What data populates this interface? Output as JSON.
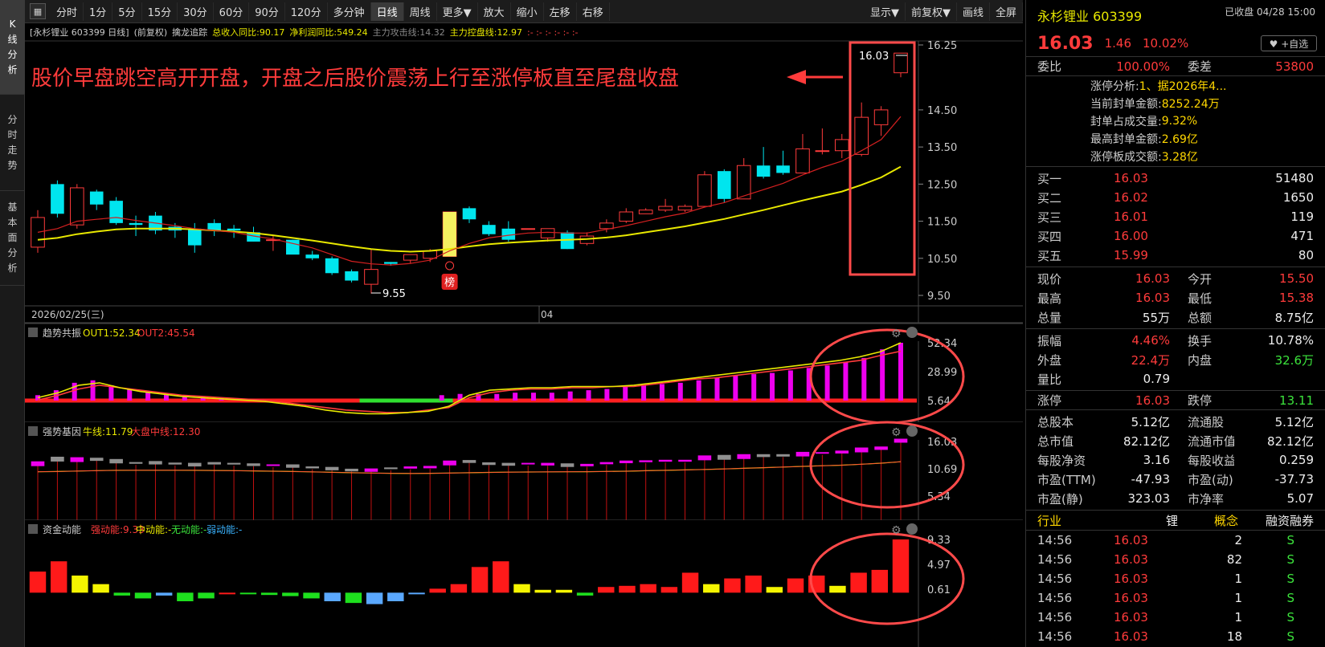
{
  "left_nav": [
    {
      "label": "K线分析",
      "active": true
    },
    {
      "label": "分时走势",
      "active": false
    },
    {
      "label": "基本面分析",
      "active": false
    }
  ],
  "toolbar": {
    "left": [
      "分时",
      "1分",
      "5分",
      "15分",
      "30分",
      "60分",
      "90分",
      "120分",
      "多分钟",
      "日线",
      "周线",
      "更多▼",
      "放大",
      "缩小",
      "左移",
      "右移"
    ],
    "active": "日线",
    "right": [
      "显示▼",
      "前复权▼",
      "画线",
      "全屏"
    ]
  },
  "infobar": {
    "stock": "[永杉锂业 603399 日线]",
    "adj": "(前复权)",
    "indicator": "擒龙追踪",
    "revenue": "总收入同比:90.17",
    "profit": "净利润同比:549.24",
    "attack": "主力攻击线:14.32",
    "control": "主力控盘线:12.97",
    "marks": ":- :- :- :- :- :-"
  },
  "main_chart": {
    "annotation": "股价早盘跳空高开开盘，开盘之后股价震荡上行至涨停板直至尾盘收盘",
    "label_high": "16.03",
    "label_low": "9.55",
    "date_left": "2026/02/25(三)",
    "date_mid": "04",
    "badge": "榜",
    "y_ticks": [
      "16.25",
      "14.50",
      "13.50",
      "12.50",
      "11.50",
      "10.50",
      "9.50"
    ]
  },
  "ind1": {
    "name": "趋势共振",
    "out1": "OUT1:52.34",
    "out2": "OUT2:45.54",
    "ticks": [
      "52.34",
      "28.99",
      "5.64"
    ]
  },
  "ind2": {
    "name": "强势基因",
    "bull": "牛线:11.79",
    "mid": "大盘中线:12.30",
    "ticks": [
      "16.03",
      "10.69",
      "5.34"
    ]
  },
  "ind3": {
    "name": "资金动能",
    "strong": "强动能:9.33",
    "medium": "中动能:-",
    "none": "无动能:-",
    "weak": "弱动能:-",
    "ticks": [
      "9.33",
      "4.97",
      "0.61"
    ]
  },
  "chart_data": {
    "type": "candlestick",
    "candles": [
      [
        10.8,
        11.6,
        11.8,
        10.65
      ],
      [
        12.5,
        11.7,
        12.6,
        11.6
      ],
      [
        11.4,
        12.4,
        12.5,
        11.3
      ],
      [
        12.3,
        11.95,
        12.35,
        11.8
      ],
      [
        12.05,
        11.45,
        12.15,
        11.4
      ],
      [
        11.45,
        11.4,
        11.65,
        11.1
      ],
      [
        11.65,
        11.25,
        11.75,
        11.15
      ],
      [
        11.35,
        11.25,
        11.45,
        11.05
      ],
      [
        11.3,
        10.85,
        11.45,
        10.65
      ],
      [
        11.45,
        11.25,
        11.55,
        11.1
      ],
      [
        11.3,
        11.25,
        11.4,
        11.05
      ],
      [
        11.2,
        10.95,
        11.35,
        10.95
      ],
      [
        10.98,
        11.0,
        11.1,
        10.7
      ],
      [
        11.0,
        10.6,
        11.0,
        10.7
      ],
      [
        10.6,
        10.5,
        10.7,
        10.45
      ],
      [
        10.5,
        10.1,
        10.55,
        10.05
      ],
      [
        10.15,
        9.9,
        10.2,
        9.85
      ],
      [
        9.8,
        10.2,
        10.75,
        9.55
      ],
      [
        10.4,
        10.35,
        10.4,
        10.3
      ],
      [
        10.45,
        10.6,
        10.6,
        10.35
      ],
      [
        10.5,
        10.7,
        10.75,
        10.4
      ],
      [
        10.55,
        11.75,
        11.75,
        10.55
      ],
      [
        11.85,
        11.55,
        11.9,
        11.45
      ],
      [
        11.4,
        11.15,
        11.5,
        11.1
      ],
      [
        11.3,
        11.0,
        11.5,
        10.95
      ],
      [
        11.3,
        11.3,
        11.3,
        11.3
      ],
      [
        11.05,
        11.3,
        11.3,
        10.95
      ],
      [
        11.2,
        10.75,
        11.25,
        10.75
      ],
      [
        10.9,
        11.1,
        11.2,
        10.85
      ],
      [
        11.3,
        11.45,
        11.55,
        11.2
      ],
      [
        11.5,
        11.75,
        11.85,
        11.45
      ],
      [
        11.7,
        11.8,
        11.85,
        11.7
      ],
      [
        11.8,
        11.9,
        12.1,
        11.75
      ],
      [
        11.8,
        11.9,
        11.95,
        11.75
      ],
      [
        11.9,
        12.75,
        12.85,
        11.9
      ],
      [
        12.85,
        12.1,
        12.9,
        12.0
      ],
      [
        12.1,
        13.0,
        13.2,
        12.1
      ],
      [
        13.0,
        12.7,
        13.5,
        12.65
      ],
      [
        13.0,
        12.8,
        13.4,
        12.75
      ],
      [
        12.8,
        13.45,
        13.85,
        12.8
      ],
      [
        13.4,
        13.4,
        14.0,
        13.3
      ],
      [
        13.4,
        13.7,
        13.85,
        13.2
      ],
      [
        13.3,
        14.3,
        14.7,
        13.25
      ],
      [
        14.1,
        14.5,
        14.6,
        13.8
      ],
      [
        15.5,
        16.03,
        16.03,
        15.38
      ]
    ],
    "ma_red": [
      11.2,
      11.3,
      11.5,
      11.55,
      11.6,
      11.52,
      11.45,
      11.38,
      11.3,
      11.25,
      11.2,
      11.1,
      11.02,
      10.9,
      10.78,
      10.6,
      10.42,
      10.35,
      10.32,
      10.36,
      10.45,
      10.7,
      10.9,
      11.05,
      11.12,
      11.18,
      11.2,
      11.18,
      11.18,
      11.28,
      11.38,
      11.5,
      11.62,
      11.72,
      11.88,
      12.0,
      12.18,
      12.35,
      12.52,
      12.75,
      12.95,
      13.12,
      13.4,
      13.7,
      14.32
    ],
    "ma_yellow": [
      11.0,
      11.05,
      11.15,
      11.22,
      11.28,
      11.3,
      11.3,
      11.3,
      11.28,
      11.25,
      11.22,
      11.18,
      11.12,
      11.05,
      10.98,
      10.9,
      10.82,
      10.75,
      10.7,
      10.68,
      10.7,
      10.75,
      10.82,
      10.88,
      10.92,
      10.95,
      10.98,
      11.0,
      11.02,
      11.06,
      11.12,
      11.2,
      11.28,
      11.36,
      11.46,
      11.56,
      11.68,
      11.8,
      11.93,
      12.06,
      12.18,
      12.3,
      12.48,
      12.68,
      12.97
    ],
    "ind1_bars": [
      10,
      14,
      20,
      22,
      18,
      15,
      13,
      11,
      10,
      9,
      8,
      7,
      6,
      5,
      3,
      1,
      0,
      0,
      0,
      0,
      0,
      2,
      10,
      11,
      11,
      11,
      12,
      12,
      12,
      13,
      14,
      15,
      17,
      18,
      19,
      20,
      22,
      24,
      26,
      27,
      28,
      30,
      32,
      34,
      37,
      40,
      47,
      52.34
    ],
    "ind1_out1": [
      8,
      12,
      18,
      20,
      16,
      13,
      11,
      9,
      8,
      7,
      6,
      5,
      3,
      1,
      -2,
      -4,
      -5,
      -5,
      -4,
      -3,
      1,
      10,
      14,
      15,
      16,
      16,
      17,
      17,
      17,
      18,
      20,
      22,
      24,
      26,
      28,
      30,
      32,
      34,
      36,
      38,
      41,
      45,
      52.34
    ],
    "ind1_out2": [
      6,
      10,
      15,
      18,
      16,
      14,
      12,
      10,
      9,
      8,
      7,
      6,
      4,
      2,
      0,
      -2,
      -3,
      -4,
      -4,
      -2,
      0,
      8,
      12,
      14,
      15,
      15,
      16,
      16,
      17,
      17,
      19,
      21,
      23,
      24,
      26,
      28,
      30,
      32,
      34,
      36,
      38,
      42,
      45.54
    ],
    "ind1_base": [
      "red",
      "red",
      "red",
      "red",
      "red",
      "red",
      "red",
      "red",
      "red",
      "red",
      "red",
      "red",
      "red",
      "red",
      "red",
      "red",
      "green",
      "green",
      "green",
      "green",
      "green",
      "green",
      "red",
      "red",
      "red",
      "red",
      "red",
      "red",
      "red",
      "red",
      "red",
      "red",
      "red",
      "red",
      "red",
      "red",
      "red",
      "red",
      "red",
      "red",
      "red",
      "red",
      "red",
      "red",
      "red"
    ],
    "ind3_bars": [
      3.7,
      5.5,
      3.0,
      1.5,
      -0.5,
      -1.0,
      -0.5,
      -1.5,
      -1.0,
      0.0,
      -0.2,
      -0.4,
      -0.6,
      -1.0,
      -1.5,
      -1.8,
      -2.0,
      -1.5,
      -0.2,
      0.7,
      1.5,
      4.5,
      5.5,
      1.5,
      0.5,
      0.5,
      -0.5,
      1.0,
      1.2,
      1.5,
      1.0,
      3.5,
      1.5,
      2.5,
      3.0,
      1.0,
      2.5,
      3.0,
      1.2,
      3.5,
      4.0,
      9.33
    ],
    "ind3_colors": [
      "red",
      "red",
      "yellow",
      "yellow",
      "green",
      "green",
      "blue",
      "green",
      "green",
      "red",
      "green",
      "green",
      "green",
      "green",
      "blue",
      "green",
      "blue",
      "blue",
      "blue",
      "red",
      "red",
      "red",
      "red",
      "yellow",
      "yellow",
      "yellow",
      "green",
      "red",
      "red",
      "red",
      "red",
      "red",
      "yellow",
      "red",
      "red",
      "yellow",
      "red",
      "red",
      "yellow",
      "red",
      "red",
      "red"
    ]
  },
  "right_panel": {
    "name": "永杉锂业 603399",
    "closed": "已收盘 04/28 15:00",
    "price": "16.03",
    "change": "1.46",
    "pct": "10.02%",
    "fav": "♥ +自选",
    "weibi_label": "委比",
    "weibi": "100.00%",
    "weicha_label": "委差",
    "weicha": "53800",
    "zt_analysis": [
      {
        "label": "涨停分析:",
        "value": "1、据2026年4..."
      },
      {
        "label": "当前封单金额:",
        "value": "8252.24万"
      },
      {
        "label": "封单占成交量:",
        "value": "9.32%"
      },
      {
        "label": "最高封单金额:",
        "value": "2.69亿"
      },
      {
        "label": "涨停板成交额:",
        "value": "3.28亿"
      }
    ],
    "buy": [
      {
        "label": "买一",
        "price": "16.03",
        "vol": "51480"
      },
      {
        "label": "买二",
        "price": "16.02",
        "vol": "1650"
      },
      {
        "label": "买三",
        "price": "16.01",
        "vol": "119"
      },
      {
        "label": "买四",
        "price": "16.00",
        "vol": "471"
      },
      {
        "label": "买五",
        "price": "15.99",
        "vol": "80"
      }
    ],
    "quote": [
      {
        "l1": "现价",
        "v1": "16.03",
        "c1": "red",
        "l2": "今开",
        "v2": "15.50",
        "c2": "red"
      },
      {
        "l1": "最高",
        "v1": "16.03",
        "c1": "red",
        "l2": "最低",
        "v2": "15.38",
        "c2": "red"
      },
      {
        "l1": "总量",
        "v1": "55万",
        "c1": "wht",
        "l2": "总额",
        "v2": "8.75亿",
        "c2": "wht"
      }
    ],
    "quote2": [
      {
        "l1": "振幅",
        "v1": "4.46%",
        "c1": "red",
        "l2": "换手",
        "v2": "10.78%",
        "c2": "wht"
      },
      {
        "l1": "外盘",
        "v1": "22.4万",
        "c1": "red",
        "l2": "内盘",
        "v2": "32.6万",
        "c2": "grn"
      },
      {
        "l1": "量比",
        "v1": "0.79",
        "c1": "wht",
        "l2": "",
        "v2": "",
        "c2": "wht"
      }
    ],
    "limit": {
      "l1": "涨停",
      "v1": "16.03",
      "l2": "跌停",
      "v2": "13.11"
    },
    "fund": [
      {
        "l1": "总股本",
        "v1": "5.12亿",
        "l2": "流通股",
        "v2": "5.12亿"
      },
      {
        "l1": "总市值",
        "v1": "82.12亿",
        "l2": "流通市值",
        "v2": "82.12亿"
      },
      {
        "l1": "每股净资",
        "v1": "3.16",
        "l2": "每股收益",
        "v2": "0.259"
      },
      {
        "l1": "市盈(TTM)",
        "v1": "-47.93",
        "l2": "市盈(动)",
        "v2": "-37.73"
      },
      {
        "l1": "市盈(静)",
        "v1": "323.03",
        "l2": "市净率",
        "v2": "5.07"
      }
    ],
    "tabs": [
      "行业",
      "锂",
      "概念",
      "融资融券"
    ],
    "ticks": [
      {
        "time": "14:56",
        "price": "16.03",
        "vol": "2",
        "side": "S"
      },
      {
        "time": "14:56",
        "price": "16.03",
        "vol": "82",
        "side": "S"
      },
      {
        "time": "14:56",
        "price": "16.03",
        "vol": "1",
        "side": "S"
      },
      {
        "time": "14:56",
        "price": "16.03",
        "vol": "1",
        "side": "S"
      },
      {
        "time": "14:56",
        "price": "16.03",
        "vol": "1",
        "side": "S"
      },
      {
        "time": "14:56",
        "price": "16.03",
        "vol": "18",
        "side": "S"
      }
    ]
  }
}
